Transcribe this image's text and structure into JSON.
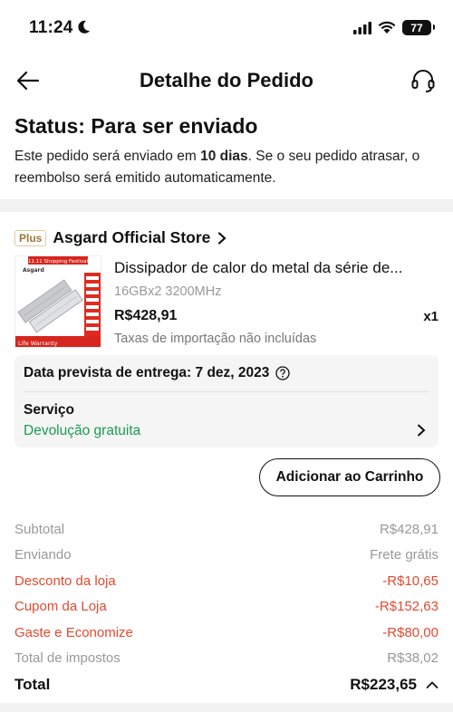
{
  "status_bar": {
    "time": "11:24",
    "battery": "77"
  },
  "header": {
    "title": "Detalhe do Pedido"
  },
  "order_status": {
    "title": "Status: Para ser enviado",
    "desc_prefix": "Este pedido será enviado em ",
    "desc_bold": "10 dias",
    "desc_suffix": ". Se o seu pedido atrasar, o reembolso será emitido automaticamente."
  },
  "store": {
    "badge": "Plus",
    "name": "Asgard Official Store"
  },
  "product": {
    "name": "Dissipador de calor do metal da série de...",
    "variant": "16GBx2 3200MHz",
    "price": "R$428,91",
    "quantity": "x1",
    "tax_note": "Taxas de importação não incluídas",
    "image_banner": "11.11 Shopping Festival",
    "image_brand": "Asgard",
    "image_warranty": "Life Warranty"
  },
  "delivery": {
    "estimate": "Data prevista de entrega: 7 dez, 2023",
    "service_label": "Serviço",
    "service_value": "Devolução gratuita"
  },
  "actions": {
    "add_to_cart": "Adicionar ao Carrinho"
  },
  "summary": {
    "rows": [
      {
        "label": "Subtotal",
        "value": "R$428,91",
        "tone": "gray"
      },
      {
        "label": "Enviando",
        "value": "Frete grátis",
        "tone": "gray"
      },
      {
        "label": "Desconto da loja",
        "value": "-R$10,65",
        "tone": "red"
      },
      {
        "label": "Cupom da Loja",
        "value": "-R$152,63",
        "tone": "red"
      },
      {
        "label": "Gaste e Economize",
        "value": "-R$80,00",
        "tone": "red"
      },
      {
        "label": "Total de impostos",
        "value": "R$38,02",
        "tone": "gray"
      }
    ],
    "total_label": "Total",
    "total_value": "R$223,65"
  },
  "colors": {
    "discount_red": "#e24a2f",
    "service_green": "#1a9a53",
    "plus_gold": "#a0773c"
  },
  "icons": [
    "back-arrow-icon",
    "headset-icon",
    "chevron-right-icon",
    "help-circle-icon",
    "chevron-up-icon"
  ]
}
